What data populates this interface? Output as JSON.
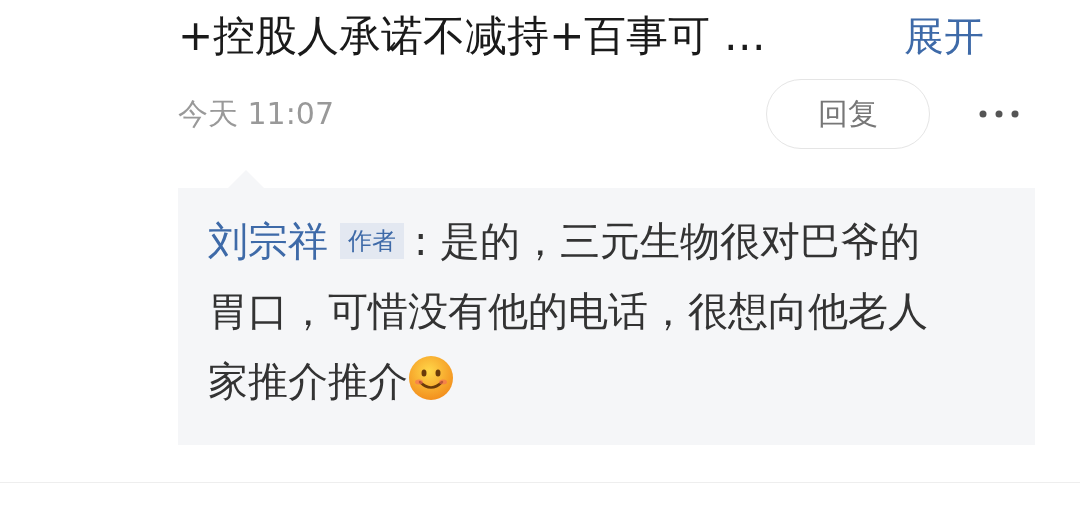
{
  "post": {
    "text_tail": "+控股人承诺不减持+百事可 …",
    "expand_link": "展开",
    "time": "今天 11:07",
    "reply_button": "回复"
  },
  "reply": {
    "author": "刘宗祥",
    "badge": "作者",
    "text_lines": [
      ": 是的，三元生物很对巴爷的",
      "胃口，可惜没有他的电话，很想向他老人",
      "家推介推介"
    ]
  }
}
